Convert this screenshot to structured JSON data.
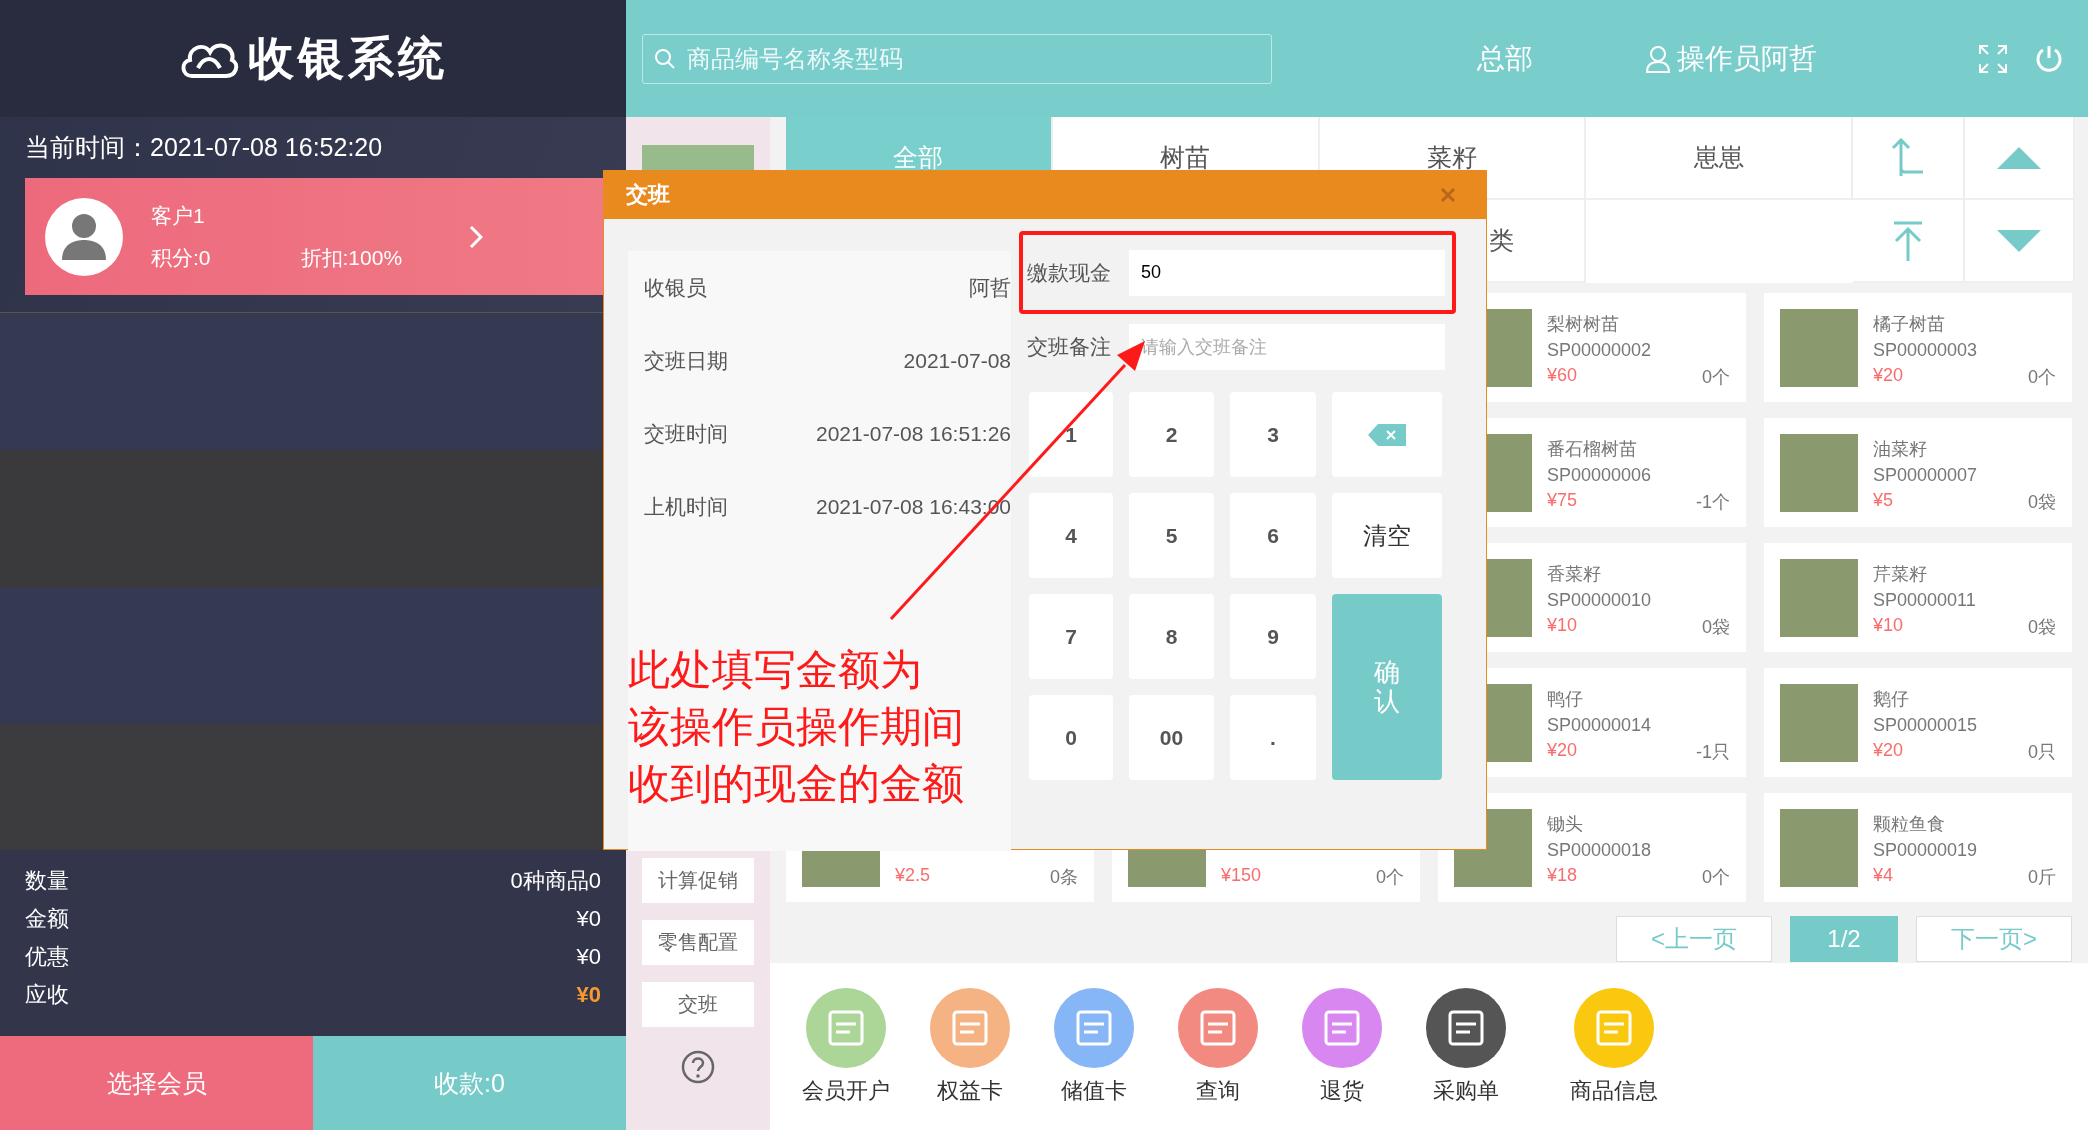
{
  "header": {
    "logo_text": "收银系统",
    "search": {
      "placeholder": "商品编号名称条型码"
    },
    "store": "总部",
    "operator": "操作员阿哲"
  },
  "left": {
    "time_label": "当前时间：",
    "time": "2021-07-08 16:52:20",
    "customer": {
      "name": "客户1",
      "points": "积分:0",
      "discount": "折扣:100%"
    },
    "summary": [
      {
        "label": "数量",
        "value": "0种商品0",
        "highlight": false
      },
      {
        "label": "金额",
        "value": "¥0",
        "highlight": false
      },
      {
        "label": "优惠",
        "value": "¥0",
        "highlight": false
      },
      {
        "label": "应收",
        "value": "¥0",
        "highlight": true
      }
    ],
    "buttons": [
      {
        "label": "选择会员",
        "kind": "member"
      },
      {
        "label": "收款:0",
        "kind": "pay"
      }
    ]
  },
  "side_buttons": [
    {
      "label": "计算促销"
    },
    {
      "label": "零售配置"
    },
    {
      "label": "交班"
    }
  ],
  "categories": [
    {
      "label": "全部",
      "selected": true
    },
    {
      "label": "树苗",
      "selected": false
    },
    {
      "label": "菜籽",
      "selected": false
    },
    {
      "label": "崽崽",
      "selected": false
    },
    {
      "label": "类",
      "selected": false
    }
  ],
  "products": [
    {
      "items": [
        {
          "name": "梨树树苗",
          "code": "SP00000002",
          "price": "¥60",
          "stock": "0个"
        },
        {
          "name": "橘子树苗",
          "code": "SP00000003",
          "price": "¥20",
          "stock": "0个"
        }
      ]
    },
    {
      "items": [
        {
          "name": "番石榴树苗",
          "code": "SP00000006",
          "price": "¥75",
          "stock": "-1个"
        },
        {
          "name": "油菜籽",
          "code": "SP00000007",
          "price": "¥5",
          "stock": "0袋"
        }
      ]
    },
    {
      "items": [
        {
          "name": "香菜籽",
          "code": "SP00000010",
          "price": "¥10",
          "stock": "0袋"
        },
        {
          "name": "芹菜籽",
          "code": "SP00000011",
          "price": "¥10",
          "stock": "0袋"
        }
      ]
    },
    {
      "items": [
        {
          "name": "鸭仔",
          "code": "SP00000014",
          "price": "¥20",
          "stock": "-1只"
        },
        {
          "name": "鹅仔",
          "code": "SP00000015",
          "price": "¥20",
          "stock": "0只"
        }
      ]
    },
    {
      "items": [
        {
          "price": "¥2.5",
          "stock": "0条"
        },
        {
          "price": "¥150",
          "stock": "0个"
        },
        {
          "name": "锄头",
          "code": "SP00000018",
          "price": "¥18",
          "stock": "0个"
        },
        {
          "name": "颗粒鱼食",
          "code": "SP00000019",
          "price": "¥4",
          "stock": "0斤"
        }
      ]
    }
  ],
  "pagination": {
    "prev": "<上一页",
    "page": "1/2",
    "next": "下一页>"
  },
  "toolbar": [
    {
      "label": "会员开户",
      "color": "#acd598"
    },
    {
      "label": "权益卡",
      "color": "#f5b283"
    },
    {
      "label": "储值卡",
      "color": "#86b6f6"
    },
    {
      "label": "查询",
      "color": "#f28a82"
    },
    {
      "label": "退货",
      "color": "#d887f0"
    },
    {
      "label": "采购单",
      "color": "#555555"
    },
    {
      "label": "商品信息",
      "color": "#fac80f"
    }
  ],
  "dialog": {
    "title": "交班",
    "info": [
      {
        "label": "收银员",
        "value": "阿哲"
      },
      {
        "label": "交班日期",
        "value": "2021-07-08"
      },
      {
        "label": "交班时间",
        "value": "2021-07-08 16:51:26"
      },
      {
        "label": "上机时间",
        "value": "2021-07-08 16:43:00"
      }
    ],
    "cash": {
      "label": "缴款现金",
      "value": "50"
    },
    "note": {
      "label": "交班备注",
      "placeholder": "请输入交班备注"
    },
    "keys": [
      {
        "kind": "digit",
        "label": "1"
      },
      {
        "kind": "digit",
        "label": "2"
      },
      {
        "kind": "digit",
        "label": "3"
      },
      {
        "kind": "backspace"
      },
      {
        "kind": "digit",
        "label": "4"
      },
      {
        "kind": "digit",
        "label": "5"
      },
      {
        "kind": "digit",
        "label": "6"
      },
      {
        "kind": "clear",
        "label": "清空"
      },
      {
        "kind": "digit",
        "label": "7"
      },
      {
        "kind": "digit",
        "label": "8"
      },
      {
        "kind": "digit",
        "label": "9"
      },
      {
        "kind": "confirm",
        "label": "确认"
      },
      {
        "kind": "digit",
        "label": "0"
      },
      {
        "kind": "digit",
        "label": "00"
      },
      {
        "kind": "digit",
        "label": "."
      }
    ]
  },
  "annotation": {
    "lines": [
      "此处填写金额为",
      "该操作员操作期间",
      "收到的现金的金额"
    ]
  }
}
